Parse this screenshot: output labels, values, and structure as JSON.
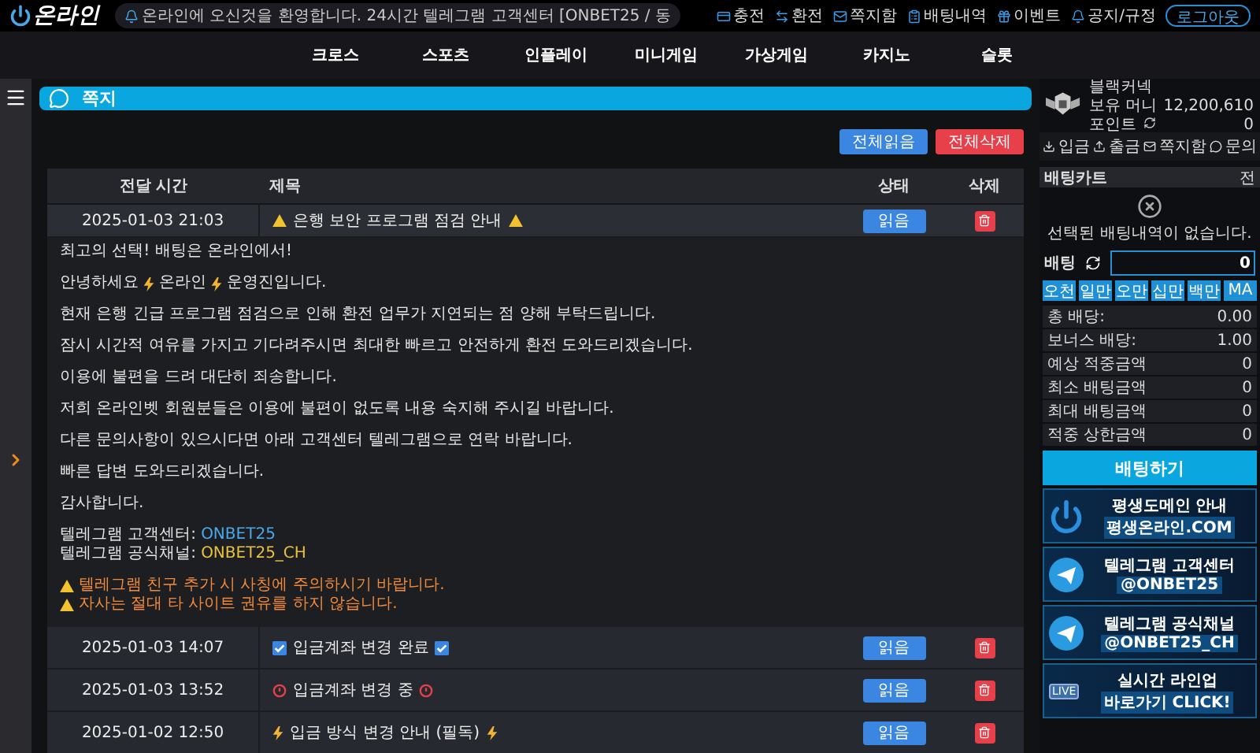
{
  "header": {
    "logo": "온라인",
    "ticker": "온라인에 오신것을 환영합니다. 24시간 텔레그램 고객센터 [ONBET25 / 동",
    "top_links": [
      "충전",
      "환전",
      "쪽지함",
      "배팅내역",
      "이벤트",
      "공지/규정"
    ],
    "logout": "로그아웃"
  },
  "nav": [
    "크로스",
    "스포츠",
    "인플레이",
    "미니게임",
    "가상게임",
    "카지노",
    "슬롯"
  ],
  "page_title": "쪽지",
  "actions": [
    {
      "label": "전체읽음",
      "kind": "read"
    },
    {
      "label": "전체삭제",
      "kind": "delete"
    }
  ],
  "table": {
    "columns": [
      "전달 시간",
      "제목",
      "상태",
      "삭제"
    ],
    "rows": [
      {
        "time": "2025-01-03 21:03",
        "title": "은행 보안 프로그램 점검 안내",
        "kind": "warning",
        "status": "읽음",
        "expanded": true,
        "body": [
          {
            "kind": "text",
            "text": "최고의 선택! 배팅은 온라인에서!"
          },
          {
            "kind": "brand",
            "prefix": "안녕하세요",
            "name": "온라인",
            "suffix": "운영진입니다."
          },
          {
            "kind": "text",
            "text": "현재 은행 긴급 프로그램 점검으로 인해 환전 업무가 지연되는 점 양해 부탁드립니다."
          },
          {
            "kind": "text",
            "text": "잠시 시간적 여유를 가지고 기다려주시면 최대한 빠르고 안전하게 환전 도와드리겠습니다."
          },
          {
            "kind": "text",
            "text": "이용에 불편을 드려 대단히 죄송합니다."
          },
          {
            "kind": "text",
            "text": "저희 온라인벳 회원분들은 이용에 불편이 없도록 내용 숙지해 주시길 바랍니다."
          },
          {
            "kind": "text",
            "text": "다른 문의사항이 있으시다면 아래 고객센터 텔레그램으로 연락 바랍니다."
          },
          {
            "kind": "text",
            "text": "빠른 답변 도와드리겠습니다."
          },
          {
            "kind": "text",
            "text": "감사합니다."
          },
          {
            "kind": "contact",
            "label": "텔레그램 고객센터:",
            "value": "ONBET25",
            "color": "#4aa8e8"
          },
          {
            "kind": "contact",
            "label": "텔레그램 공식채널:",
            "value": "ONBET25_CH",
            "color": "#e8c23a"
          },
          {
            "kind": "warning",
            "text": "텔레그램 친구 추가 시 사칭에 주의하시기 바랍니다."
          },
          {
            "kind": "warning",
            "text": "자사는 절대 타 사이트 권유를 하지 않습니다."
          }
        ]
      },
      {
        "time": "2025-01-03 14:07",
        "title": "입금계좌 변경 완료",
        "kind": "check",
        "status": "읽음",
        "expanded": false
      },
      {
        "time": "2025-01-03 13:52",
        "title": "입금계좌 변경 중",
        "kind": "alert",
        "status": "읽음",
        "expanded": false
      },
      {
        "time": "2025-01-02 12:50",
        "title": "입금 방식 변경 안내 (필독)",
        "kind": "bolt",
        "status": "읽음",
        "expanded": false
      }
    ]
  },
  "profile": {
    "name": "블랙커넥",
    "money_label": "보유 머니",
    "money": "12,200,610",
    "points_label": "포인트",
    "points": "0"
  },
  "account_tabs": [
    "입금",
    "출금",
    "쪽지함",
    "문의"
  ],
  "bet_cart": {
    "title": "배팅카트",
    "clear": "전",
    "empty": "선택된 배팅내역이 없습니다.",
    "bet_label": "배팅",
    "amount": "0",
    "quick": [
      "오천",
      "일만",
      "오만",
      "십만",
      "백만",
      "MA"
    ],
    "stats": [
      {
        "label": "총 배당:",
        "value": "0.00"
      },
      {
        "label": "보너스 배당:",
        "value": "1.00"
      },
      {
        "label": "예상 적중금액",
        "value": "0"
      },
      {
        "label": "최소 배팅금액",
        "value": "0"
      },
      {
        "label": "최대 배팅금액",
        "value": "0"
      },
      {
        "label": "적중 상한금액",
        "value": "0"
      }
    ],
    "submit": "배팅하기"
  },
  "banners": [
    {
      "kind": "power",
      "title": "평생도메인 안내",
      "sub": "평생온라인.COM"
    },
    {
      "kind": "telegram",
      "title": "텔레그램 고객센터",
      "sub": "@ONBET25"
    },
    {
      "kind": "telegram",
      "title": "텔레그램 공식채널",
      "sub": "@ONBET25_CH"
    },
    {
      "kind": "live",
      "title": "실시간 라인업",
      "sub": "바로가기",
      "extra": "CLICK!",
      "badge": "LIVE"
    }
  ]
}
